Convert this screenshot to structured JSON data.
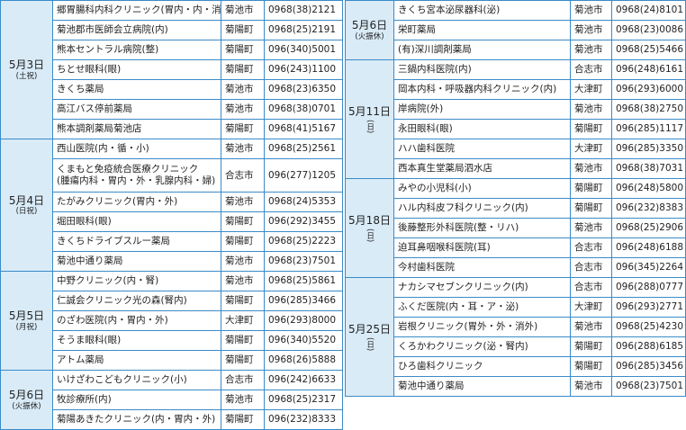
{
  "left": [
    {
      "date": "5月3日",
      "sub": "(土祝)",
      "vertical": false,
      "rows": [
        {
          "name": "郷胃腸科内科クリニック(胃内・内・消内・放)",
          "area": "菊池市",
          "phone": "0968(38)2121"
        },
        {
          "name": "菊池郡市医師会立病院(内)",
          "area": "菊陽町",
          "phone": "0968(25)2191"
        },
        {
          "name": "熊本セントラル病院(整)",
          "area": "菊陽町",
          "phone": "096(340)5001"
        },
        {
          "name": "ちとせ眼科(眼)",
          "area": "菊陽町",
          "phone": "096(243)1100"
        },
        {
          "name": "きくち薬局",
          "area": "菊池市",
          "phone": "0968(23)6350"
        },
        {
          "name": "高江バス停前薬局",
          "area": "菊池市",
          "phone": "0968(38)0701"
        },
        {
          "name": "熊本調剤薬局菊池店",
          "area": "菊陽町",
          "phone": "0968(41)5167"
        }
      ]
    },
    {
      "date": "5月4日",
      "sub": "(日祝)",
      "vertical": false,
      "rows": [
        {
          "name": "西山医院(内・循・小)",
          "area": "菊池市",
          "phone": "0968(25)2561"
        },
        {
          "name": "くまもと免疫統合医療クリニック",
          "name2": "(腫瘍内科・胃内・外・乳腺内科・婦)",
          "area": "合志市",
          "phone": "096(277)1205",
          "tall": true
        },
        {
          "name": "たがみクリニック(胃内・外)",
          "area": "菊池市",
          "phone": "0968(24)5353"
        },
        {
          "name": "堀田眼科(眼)",
          "area": "菊陽町",
          "phone": "096(292)3455"
        },
        {
          "name": "きくちドライブスルー薬局",
          "area": "菊陽町",
          "phone": "0968(25)2223"
        },
        {
          "name": "菊池中通り薬局",
          "area": "菊池市",
          "phone": "0968(23)7501"
        }
      ]
    },
    {
      "date": "5月5日",
      "sub": "(月祝)",
      "vertical": false,
      "rows": [
        {
          "name": "中野クリニック(内・腎)",
          "area": "菊池市",
          "phone": "0968(25)5861"
        },
        {
          "name": "仁誠会クリニック光の森(腎内)",
          "area": "菊陽町",
          "phone": "096(285)3466"
        },
        {
          "name": "のざわ医院(内・胃内・外)",
          "area": "大津町",
          "phone": "096(293)8000"
        },
        {
          "name": "そうま眼科(眼)",
          "area": "菊陽町",
          "phone": "096(340)5520"
        },
        {
          "name": "アトム薬局",
          "area": "菊陽町",
          "phone": "0968(26)5888"
        }
      ]
    },
    {
      "date": "5月6日",
      "sub": "(火振休)",
      "vertical": false,
      "rows": [
        {
          "name": "いけざわこどもクリニック(小)",
          "area": "合志市",
          "phone": "096(242)6633"
        },
        {
          "name": "牧診療所(内)",
          "area": "菊池市",
          "phone": "0968(25)2317"
        },
        {
          "name": "菊陽あきたクリニック(内・胃内・外)",
          "area": "菊陽町",
          "phone": "096(232)8333"
        }
      ]
    }
  ],
  "right": [
    {
      "date": "5月6日",
      "sub": "(火振休)",
      "vertical": false,
      "rows": [
        {
          "name": "きくち宮本泌尿器科(泌)",
          "area": "菊池市",
          "phone": "0968(24)8101"
        },
        {
          "name": "栄町薬局",
          "area": "菊池市",
          "phone": "0968(23)0086"
        },
        {
          "name": "(有)深川調剤薬局",
          "area": "菊池市",
          "phone": "0968(25)5466"
        }
      ]
    },
    {
      "date": "5月11日",
      "sub": "(日)",
      "vertical": true,
      "rows": [
        {
          "name": "三鍋内科医院(内)",
          "area": "合志市",
          "phone": "096(248)6161"
        },
        {
          "name": "岡本内科・呼吸器内科クリニック(内)",
          "area": "大津町",
          "phone": "096(293)6000"
        },
        {
          "name": "岸病院(外)",
          "area": "菊池市",
          "phone": "0968(38)2750"
        },
        {
          "name": "永田眼科(眼)",
          "area": "菊陽町",
          "phone": "096(285)1117"
        },
        {
          "name": "ハハ歯科医院",
          "area": "大津町",
          "phone": "096(285)3350"
        },
        {
          "name": "西本真生堂薬局泗水店",
          "area": "菊池市",
          "phone": "0968(38)7031"
        }
      ]
    },
    {
      "date": "5月18日",
      "sub": "(日)",
      "vertical": true,
      "rows": [
        {
          "name": "みやの小児科(小)",
          "area": "菊陽町",
          "phone": "096(248)5800"
        },
        {
          "name": "ハル内科皮フ科クリニック(内)",
          "area": "菊陽町",
          "phone": "096(232)8383"
        },
        {
          "name": "後藤整形外科医院(整・リハ)",
          "area": "菊池市",
          "phone": "0968(25)2906"
        },
        {
          "name": "迫耳鼻咽喉科医院(耳)",
          "area": "合志市",
          "phone": "096(248)6188"
        },
        {
          "name": "今村歯科医院",
          "area": "合志市",
          "phone": "096(345)2264"
        }
      ]
    },
    {
      "date": "5月25日",
      "sub": "(日)",
      "vertical": true,
      "rows": [
        {
          "name": "ナカシマセブンクリニック(内)",
          "area": "合志市",
          "phone": "096(288)0777"
        },
        {
          "name": "ふくだ医院(内・耳・ア・泌)",
          "area": "大津町",
          "phone": "096(293)2771"
        },
        {
          "name": "岩根クリニック(胃外・外・消外)",
          "area": "菊池市",
          "phone": "0968(25)4230"
        },
        {
          "name": "くろかわクリニック(泌・腎内)",
          "area": "菊陽町",
          "phone": "096(288)6185"
        },
        {
          "name": "ひろ歯科クリニック",
          "area": "菊陽町",
          "phone": "096(285)3456"
        },
        {
          "name": "菊池中通り薬局",
          "area": "菊池市",
          "phone": "0968(23)7501"
        }
      ]
    }
  ]
}
